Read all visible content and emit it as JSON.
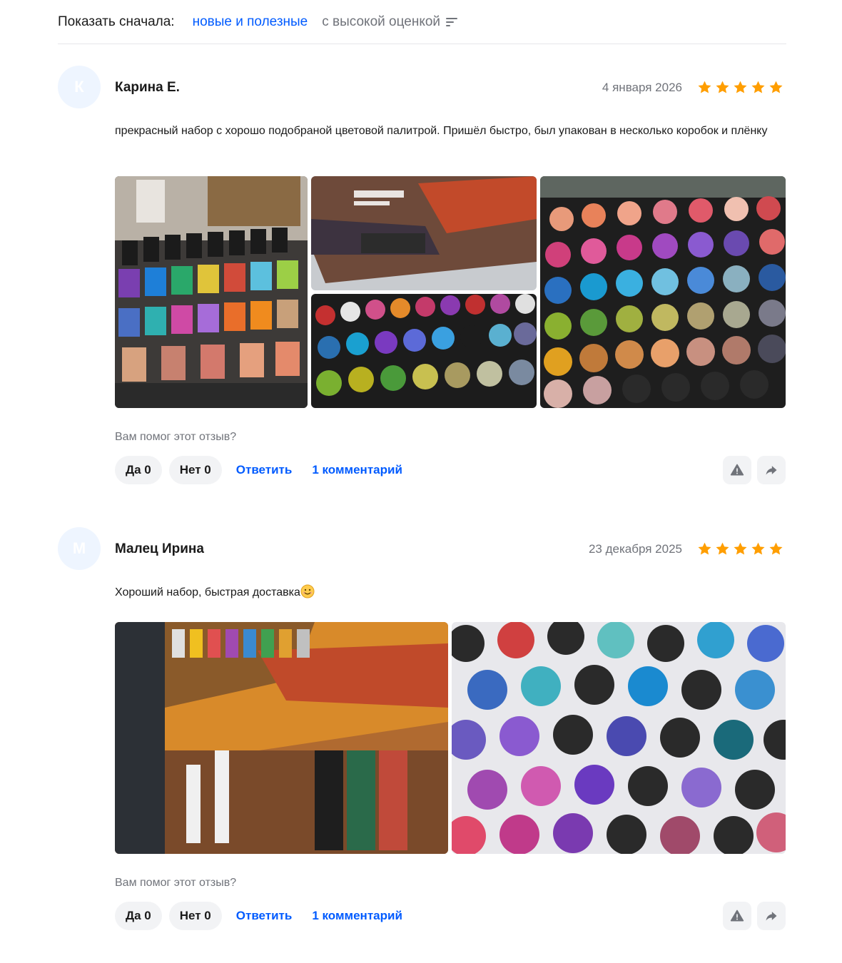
{
  "sort": {
    "label": "Показать сначала:",
    "options": [
      "новые и полезные",
      "с высокой оценкой"
    ],
    "active_index": 0
  },
  "colors": {
    "accent": "#005bff",
    "muted": "#70737a",
    "star": "#ff9e00",
    "pill_bg": "#f2f3f5"
  },
  "reviews": [
    {
      "avatar_letter": "К",
      "author": "Карина Е.",
      "date": "4 января 2026",
      "rating": 5,
      "text": "прекрасный набор с хорошо подобраной цветовой палитрой. Пришёл быстро, был упакован в несколько коробок и плёнку",
      "photos_count": 4,
      "helpful_prompt": "Вам помог этот отзыв?",
      "yes_label": "Да 0",
      "no_label": "Нет 0",
      "reply_label": "Ответить",
      "comments_label": "1 комментарий",
      "report_icon": "warning-icon",
      "share_icon": "share-arrow-icon"
    },
    {
      "avatar_letter": "М",
      "author": "Малец Ирина",
      "date": "23 декабря 2025",
      "rating": 5,
      "text": "Хороший набор, быстрая доставка",
      "text_emoji": "smiling-face-emoji",
      "photos_count": 2,
      "helpful_prompt": "Вам помог этот отзыв?",
      "yes_label": "Да 0",
      "no_label": "Нет 0",
      "reply_label": "Ответить",
      "comments_label": "1 комментарий",
      "report_icon": "warning-icon",
      "share_icon": "share-arrow-icon"
    }
  ]
}
